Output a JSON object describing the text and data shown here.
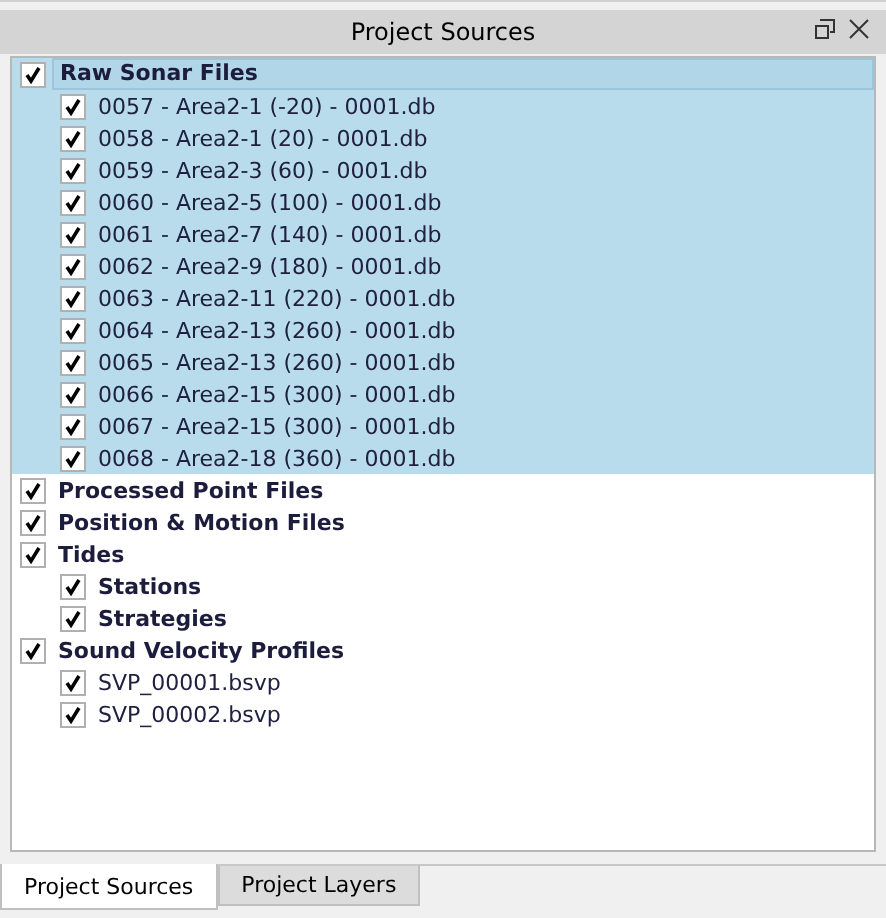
{
  "panel": {
    "title": "Project Sources"
  },
  "tree": [
    {
      "label": "Raw Sonar Files",
      "kind": "folder",
      "checked": true,
      "selected": true,
      "children": [
        {
          "label": "0057 - Area2-1 (-20) - 0001.db",
          "kind": "file",
          "checked": true,
          "selected": true
        },
        {
          "label": "0058 - Area2-1 (20) - 0001.db",
          "kind": "file",
          "checked": true,
          "selected": true
        },
        {
          "label": "0059 - Area2-3 (60) - 0001.db",
          "kind": "file",
          "checked": true,
          "selected": true
        },
        {
          "label": "0060 - Area2-5 (100) - 0001.db",
          "kind": "file",
          "checked": true,
          "selected": true
        },
        {
          "label": "0061 - Area2-7 (140) - 0001.db",
          "kind": "file",
          "checked": true,
          "selected": true
        },
        {
          "label": "0062 - Area2-9 (180) - 0001.db",
          "kind": "file",
          "checked": true,
          "selected": true
        },
        {
          "label": "0063 - Area2-11 (220) - 0001.db",
          "kind": "file",
          "checked": true,
          "selected": true
        },
        {
          "label": "0064 - Area2-13 (260) - 0001.db",
          "kind": "file",
          "checked": true,
          "selected": true
        },
        {
          "label": "0065 - Area2-13 (260) - 0001.db",
          "kind": "file",
          "checked": true,
          "selected": true
        },
        {
          "label": "0066 - Area2-15 (300) - 0001.db",
          "kind": "file",
          "checked": true,
          "selected": true
        },
        {
          "label": "0067 - Area2-15 (300) - 0001.db",
          "kind": "file",
          "checked": true,
          "selected": true
        },
        {
          "label": "0068 - Area2-18 (360) - 0001.db",
          "kind": "file",
          "checked": true,
          "selected": true
        }
      ]
    },
    {
      "label": "Processed Point Files",
      "kind": "folder",
      "checked": true,
      "selected": false
    },
    {
      "label": "Position & Motion Files",
      "kind": "folder",
      "checked": true,
      "selected": false
    },
    {
      "label": "Tides",
      "kind": "folder",
      "checked": true,
      "selected": false,
      "children": [
        {
          "label": "Stations",
          "kind": "folder",
          "checked": true,
          "selected": false
        },
        {
          "label": "Strategies",
          "kind": "folder",
          "checked": true,
          "selected": false
        }
      ]
    },
    {
      "label": "Sound Velocity Profiles",
      "kind": "folder",
      "checked": true,
      "selected": false,
      "children": [
        {
          "label": "SVP_00001.bsvp",
          "kind": "file",
          "checked": true,
          "selected": false
        },
        {
          "label": "SVP_00002.bsvp",
          "kind": "file",
          "checked": true,
          "selected": false
        }
      ]
    }
  ],
  "tabs": [
    {
      "label": "Project Sources",
      "selected": true
    },
    {
      "label": "Project Layers",
      "selected": false
    }
  ]
}
